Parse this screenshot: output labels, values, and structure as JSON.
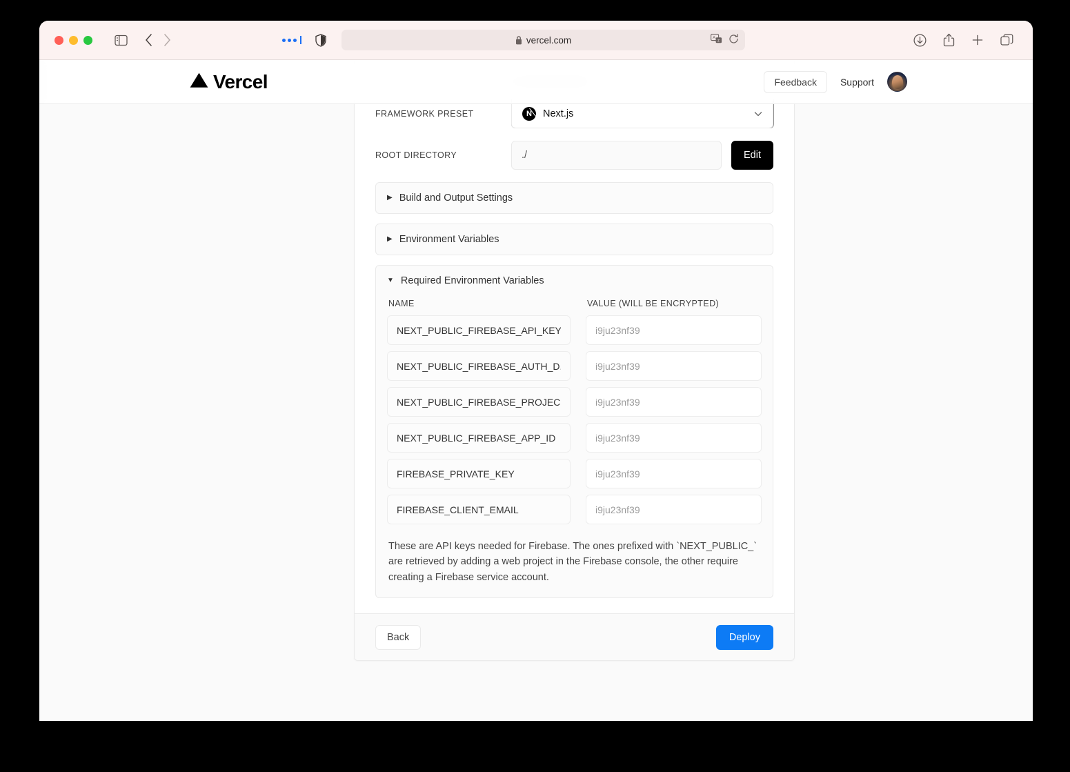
{
  "browser": {
    "url": "vercel.com",
    "toolbar_icons": {
      "sidebar": "sidebar-toggle-icon",
      "back": "chevron-left-icon",
      "forward": "chevron-right-icon",
      "reader": "reader-dots-icon",
      "privacy": "shield-icon",
      "lock": "lock-icon",
      "translate": "translate-icon",
      "reload": "reload-icon",
      "downloads": "download-icon",
      "share": "share-icon",
      "new_tab": "plus-icon",
      "tab_overview": "tab-overview-icon"
    }
  },
  "header": {
    "logo_text": "Vercel",
    "feedback_label": "Feedback",
    "support_label": "Support",
    "avatar_name": "user-avatar"
  },
  "form": {
    "framework_preset": {
      "label": "FRAMEWORK PRESET",
      "value": "Next.js",
      "icon": "nextjs-logo-icon"
    },
    "root_directory": {
      "label": "ROOT DIRECTORY",
      "value": "./",
      "edit_label": "Edit"
    }
  },
  "accordions": [
    {
      "label": "Build and Output Settings",
      "marker": "▶",
      "expanded": false
    },
    {
      "label": "Environment Variables",
      "marker": "▶",
      "expanded": false
    }
  ],
  "required_env": {
    "title": "Required Environment Variables",
    "marker": "▼",
    "expanded": true,
    "columns": {
      "name": "NAME",
      "value": "VALUE (WILL BE ENCRYPTED)"
    },
    "value_placeholder": "i9ju23nf39",
    "rows": [
      {
        "name": "NEXT_PUBLIC_FIREBASE_API_KEY",
        "value": "",
        "placeholder": "i9ju23nf39"
      },
      {
        "name": "NEXT_PUBLIC_FIREBASE_AUTH_D...",
        "value": "",
        "placeholder": "i9ju23nf39"
      },
      {
        "name": "NEXT_PUBLIC_FIREBASE_PROJEC...",
        "value": "",
        "placeholder": "i9ju23nf39"
      },
      {
        "name": "NEXT_PUBLIC_FIREBASE_APP_ID",
        "value": "",
        "placeholder": "i9ju23nf39"
      },
      {
        "name": "FIREBASE_PRIVATE_KEY",
        "value": "",
        "placeholder": "i9ju23nf39"
      },
      {
        "name": "FIREBASE_CLIENT_EMAIL",
        "value": "",
        "placeholder": "i9ju23nf39"
      }
    ],
    "description": "These are API keys needed for Firebase. The ones prefixed with `NEXT_PUBLIC_` are retrieved by adding a web project in the Firebase console, the other require creating a Firebase service account."
  },
  "footer": {
    "back_label": "Back",
    "deploy_label": "Deploy"
  },
  "colors": {
    "accent_blue": "#0d7bf5",
    "black": "#000000",
    "page_bg": "#fafafa",
    "border": "#eaeaea",
    "toolbar_bg": "#fcf2f1"
  }
}
